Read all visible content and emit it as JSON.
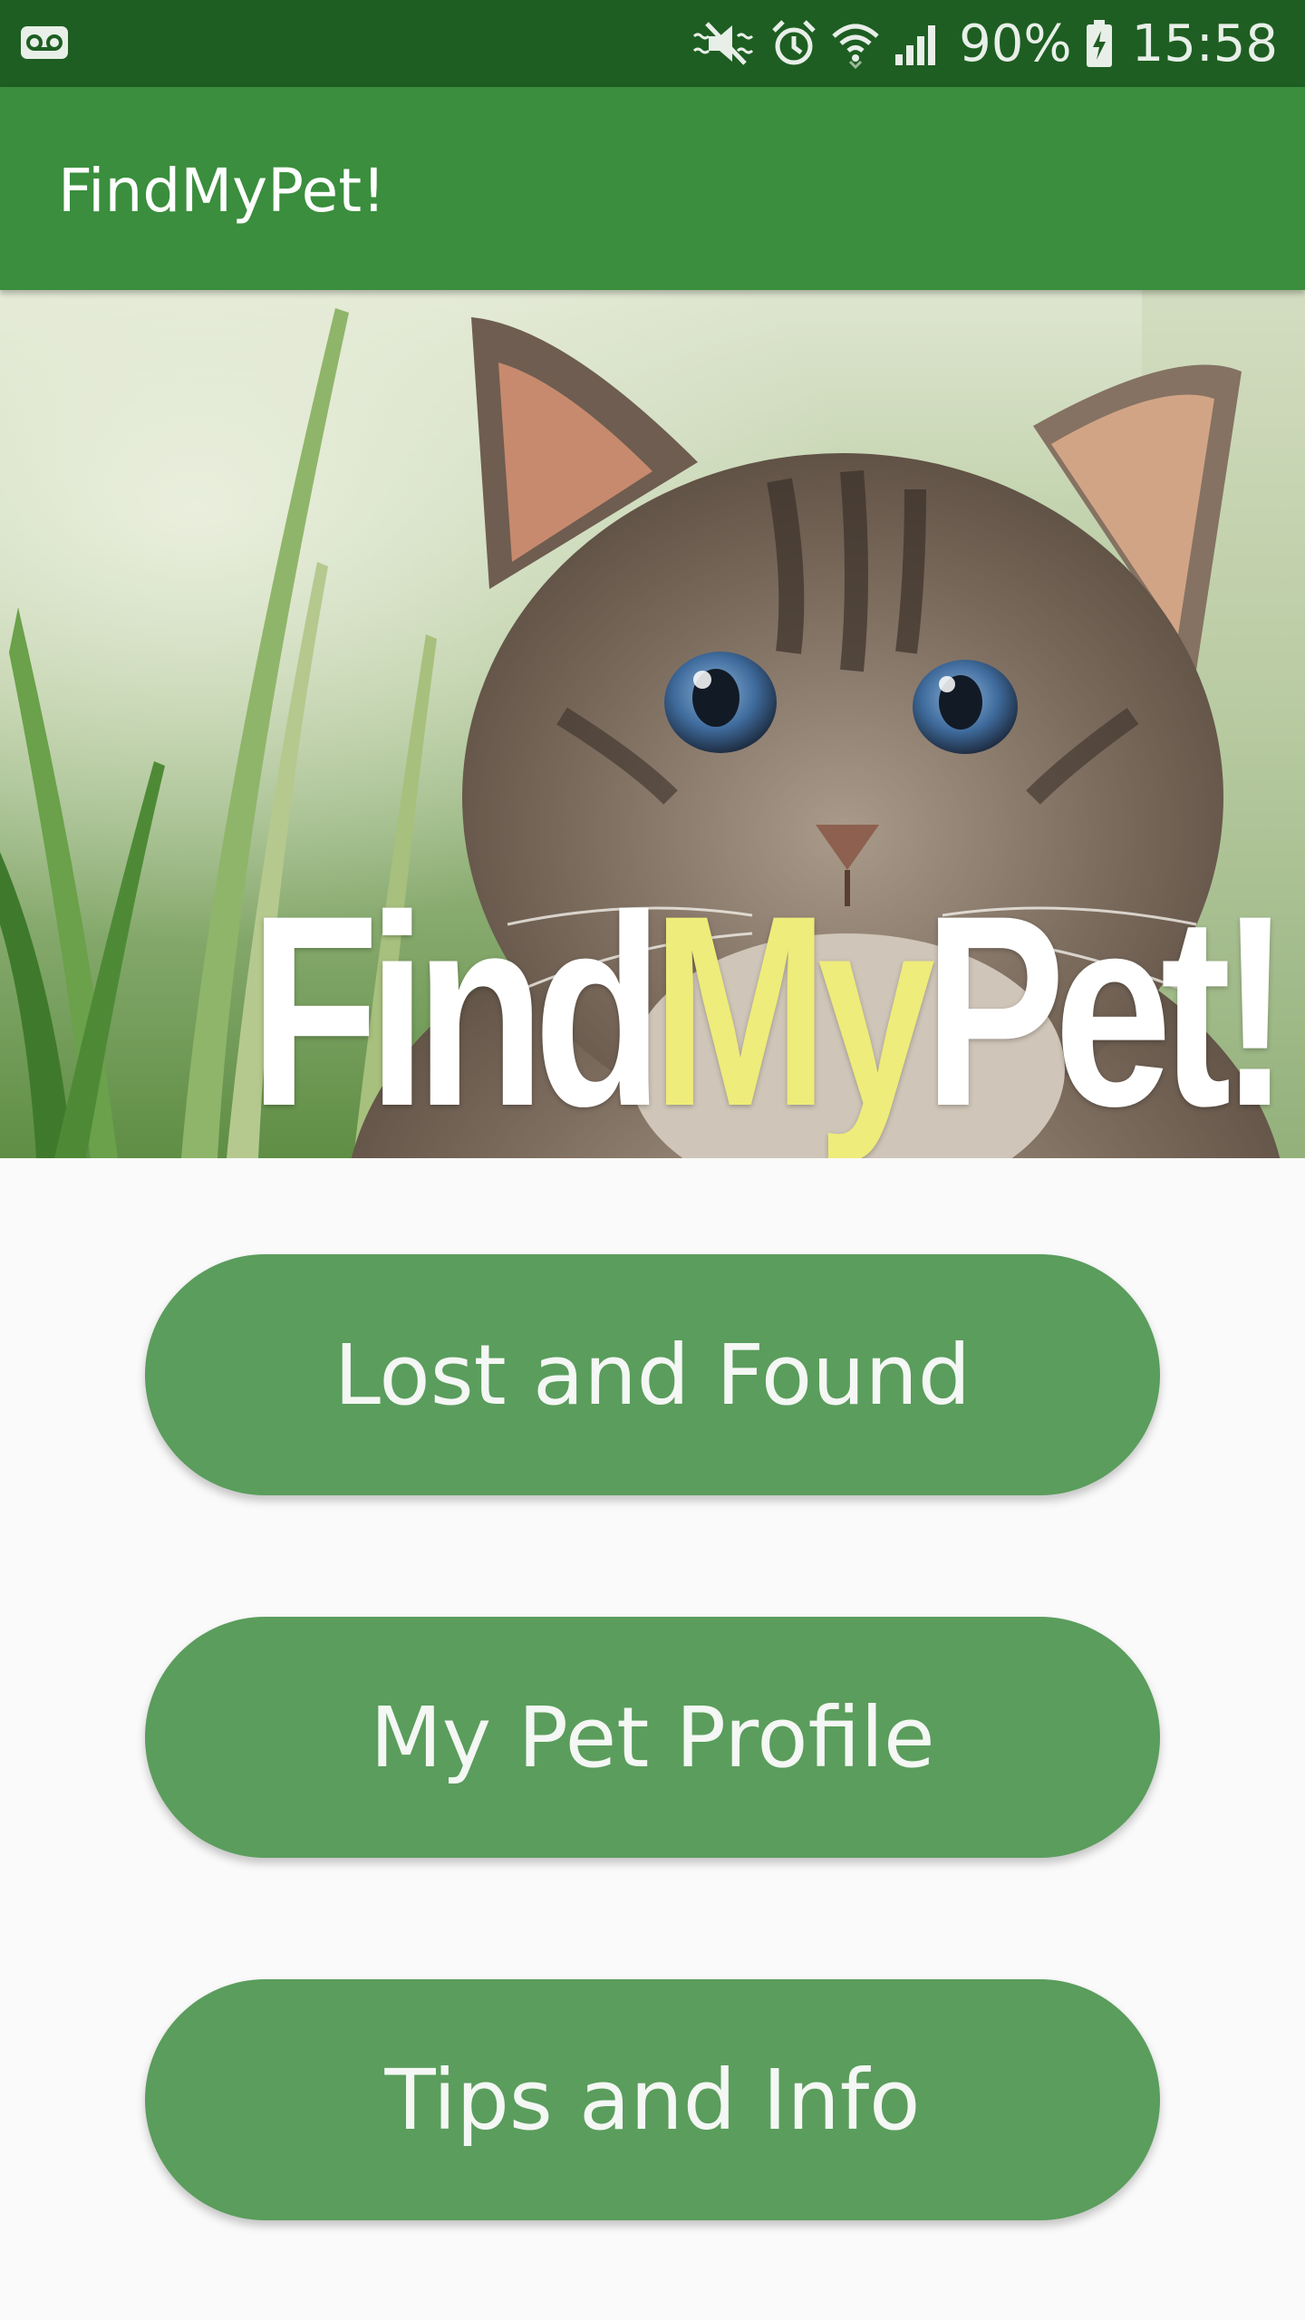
{
  "status_bar": {
    "battery_text": "90%",
    "time": "15:58",
    "icons": [
      "voicemail-icon",
      "mute-icon",
      "alarm-icon",
      "wifi-icon",
      "signal-icon",
      "battery-charging-icon"
    ]
  },
  "app_bar": {
    "title": "FindMyPet!"
  },
  "hero": {
    "logo_part1": "Find",
    "logo_part2": "My",
    "logo_part3": "Pet!",
    "logo_accent_color": "#eeec7a"
  },
  "menu": {
    "lost_and_found": "Lost and Found",
    "my_pet_profile": "My Pet Profile",
    "tips_and_info": "Tips and Info"
  },
  "colors": {
    "status_bar": "#1e5e22",
    "app_bar": "#3a8e3d",
    "button": "#5a9d5c",
    "background": "#fafafa"
  }
}
